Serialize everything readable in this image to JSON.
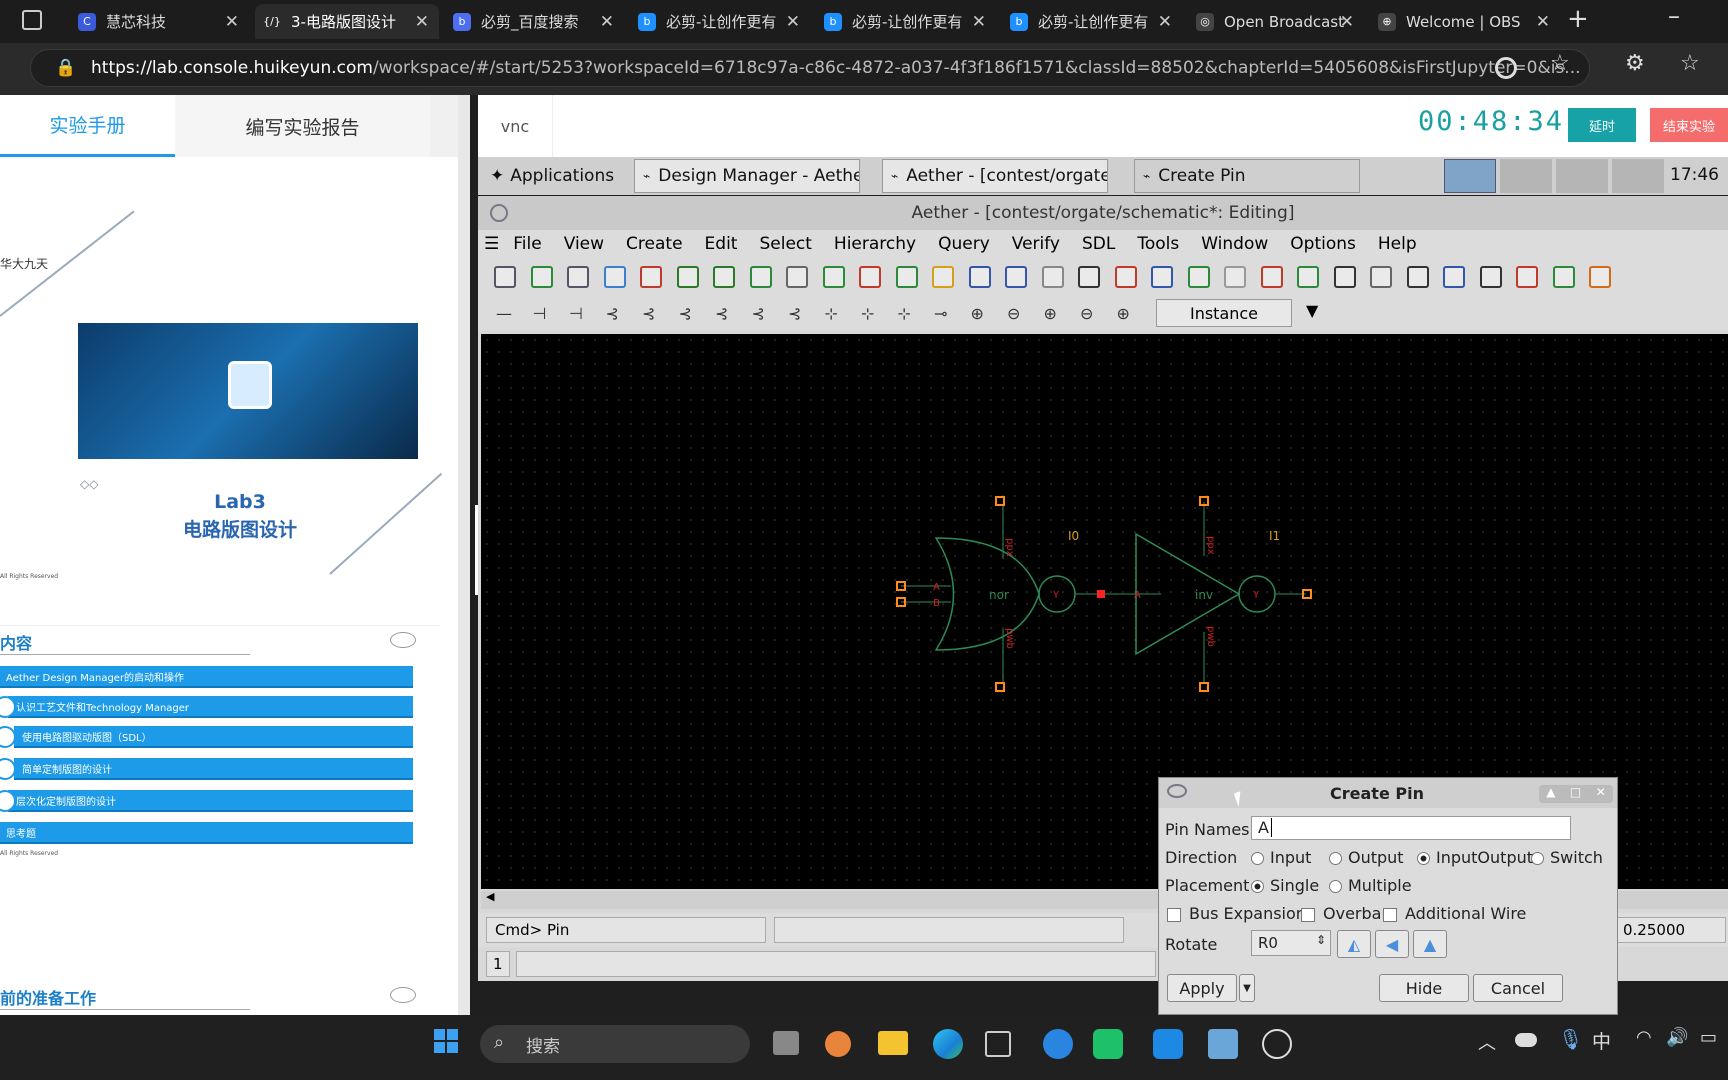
{
  "browser": {
    "tabs": [
      {
        "label": "慧芯科技",
        "color": "#3b5bdb",
        "glyph": "C"
      },
      {
        "label": "3-电路版图设计",
        "color": "#2b2b2b",
        "glyph": "{/}"
      },
      {
        "label": "必剪_百度搜索",
        "color": "#4e6ef2",
        "glyph": "b"
      },
      {
        "label": "必剪-让创作更有",
        "color": "#1e90ff",
        "glyph": "b"
      },
      {
        "label": "必剪-让创作更有",
        "color": "#1e90ff",
        "glyph": "b"
      },
      {
        "label": "必剪-让创作更有",
        "color": "#1e90ff",
        "glyph": "b"
      },
      {
        "label": "Open Broadcast",
        "color": "#444",
        "glyph": "◎"
      },
      {
        "label": "Welcome | OBS",
        "color": "#444",
        "glyph": "⊕"
      }
    ],
    "url_host": "https://lab.console.huikeyun.com",
    "url_path": "/workspace/#/start/5253?workspaceId=6718c97a-c86c-4872-a037-4f3f186f1571&classId=88502&chapterId=5405608&isFirstJupyter=0&is..."
  },
  "left": {
    "tab_manual": "实验手册",
    "tab_report": "编写实验报告",
    "slide1": {
      "org": "华大九天",
      "title1": "Lab3",
      "title2": "电路版图设计",
      "rights": "All Rights Reserved"
    },
    "slide2": {
      "heading": "内容",
      "rights": "All Rights Reserved",
      "items": [
        "Aether Design Manager的启动和操作",
        "认识工艺文件和Technology Manager",
        "使用电路图驱动版图（SDL）",
        "简单定制版图的设计",
        "层次化定制版图的设计",
        "思考题"
      ]
    },
    "slide3": {
      "heading": "前的准备工作"
    }
  },
  "vnc": {
    "tab": "vnc",
    "timer": "00:48:34",
    "extend": "延时",
    "end": "结束实验",
    "xtaskbar": {
      "apps": "Applications",
      "btn1": "Design Manager - Aether",
      "btn2": "Aether - [contest/orgate/...",
      "btn3": "Create Pin",
      "clock": "17:46"
    }
  },
  "aether": {
    "title": "Aether - [contest/orgate/schematic*: Editing]",
    "menu": [
      "File",
      "View",
      "Create",
      "Edit",
      "Select",
      "Hierarchy",
      "Query",
      "Verify",
      "SDL",
      "Tools",
      "Window",
      "Options",
      "Help"
    ],
    "instance_label": "Instance",
    "cmd": "Cmd> Pin",
    "coord": "0.25000",
    "row_num": "1",
    "schematic": {
      "inst0": "I0",
      "inst1": "I1",
      "gate0": "nor",
      "gate1": "inv",
      "pinA": "A",
      "pinB": "B",
      "pinY": "Y",
      "ppx": "ppx",
      "pwb": "pwb"
    }
  },
  "dialog": {
    "title": "Create Pin",
    "pin_names_label": "Pin Names",
    "pin_names_value": "A",
    "direction_label": "Direction",
    "dir_input": "Input",
    "dir_output": "Output",
    "dir_inout": "InputOutput",
    "dir_switch": "Switch",
    "placement_label": "Placement",
    "place_single": "Single",
    "place_multiple": "Multiple",
    "bus": "Bus Expansion",
    "overbar": "Overbar",
    "addwire": "Additional Wire",
    "rotate_label": "Rotate",
    "rotate_value": "R0",
    "apply": "Apply",
    "hide": "Hide",
    "cancel": "Cancel"
  },
  "taskbar": {
    "search": "搜索",
    "ime": "中"
  }
}
